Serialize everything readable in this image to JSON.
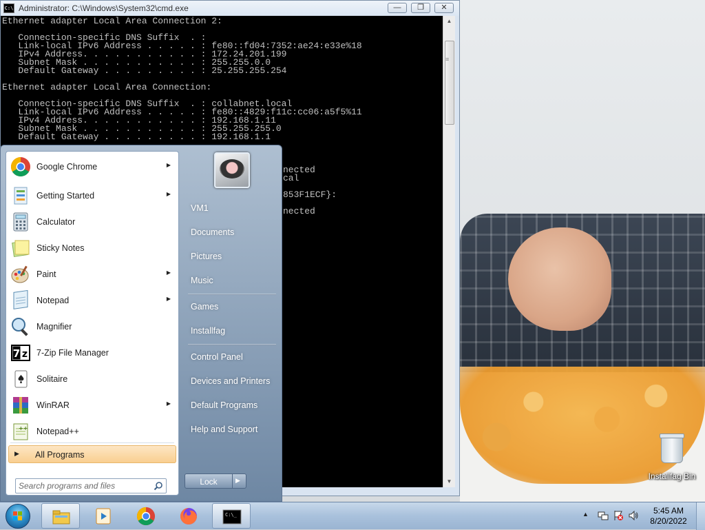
{
  "window": {
    "title": "Administrator: C:\\Windows\\System32\\cmd.exe",
    "minimize_label": "—",
    "maximize_label": "❐",
    "close_label": "✕",
    "console_lines": "Ethernet adapter Local Area Connection 2:\n\n   Connection-specific DNS Suffix  . :\n   Link-local IPv6 Address . . . . . : fe80::fd04:7352:ae24:e33e%18\n   IPv4 Address. . . . . . . . . . . : 172.24.201.199\n   Subnet Mask . . . . . . . . . . . : 255.255.0.0\n   Default Gateway . . . . . . . . . : 25.255.255.254\n\nEthernet adapter Local Area Connection:\n\n   Connection-specific DNS Suffix  . : collabnet.local\n   Link-local IPv6 Address . . . . . : fe80::4829:f11c:cc06:a5f5%11\n   IPv4 Address. . . . . . . . . . . : 192.168.1.11\n   Subnet Mask . . . . . . . . . . . : 255.255.255.0\n   Default Gateway . . . . . . . . . : 192.168.1.1",
    "console_tail": [
      "nected",
      "cal",
      "853F1ECF}:",
      "nected"
    ]
  },
  "start_menu": {
    "programs": [
      {
        "label": "Google Chrome",
        "icon": "chrome-icon",
        "has_submenu": true
      },
      {
        "label": "Getting Started",
        "icon": "getting-started-icon",
        "has_submenu": true
      },
      {
        "label": "Calculator",
        "icon": "calculator-icon",
        "has_submenu": false
      },
      {
        "label": "Sticky Notes",
        "icon": "sticky-notes-icon",
        "has_submenu": false
      },
      {
        "label": "Paint",
        "icon": "paint-icon",
        "has_submenu": true
      },
      {
        "label": "Notepad",
        "icon": "notepad-icon",
        "has_submenu": true
      },
      {
        "label": "Magnifier",
        "icon": "magnifier-icon",
        "has_submenu": false
      },
      {
        "label": "7-Zip File Manager",
        "icon": "7zip-icon",
        "has_submenu": false
      },
      {
        "label": "Solitaire",
        "icon": "solitaire-icon",
        "has_submenu": false
      },
      {
        "label": "WinRAR",
        "icon": "winrar-icon",
        "has_submenu": true
      },
      {
        "label": "Notepad++",
        "icon": "notepadpp-icon",
        "has_submenu": false
      }
    ],
    "all_programs_label": "All Programs",
    "search_placeholder": "Search programs and files",
    "places": [
      "VM1",
      "Documents",
      "Pictures",
      "Music",
      "Games",
      "Installfag",
      "Control Panel",
      "Devices and Printers",
      "Default Programs",
      "Help and Support"
    ],
    "lock_label": "Lock"
  },
  "desktop": {
    "recycle_bin_label": "Installfag Bin"
  },
  "taskbar": {
    "apps": [
      "explorer-icon",
      "media-player-icon",
      "chrome-icon",
      "firefox-icon",
      "cmd-icon"
    ],
    "time": "5:45 AM",
    "date": "8/20/2022"
  },
  "colors": {
    "console_bg": "#000000",
    "console_fg": "#c0c0c0",
    "all_programs_highlight": "#f9cf90"
  }
}
